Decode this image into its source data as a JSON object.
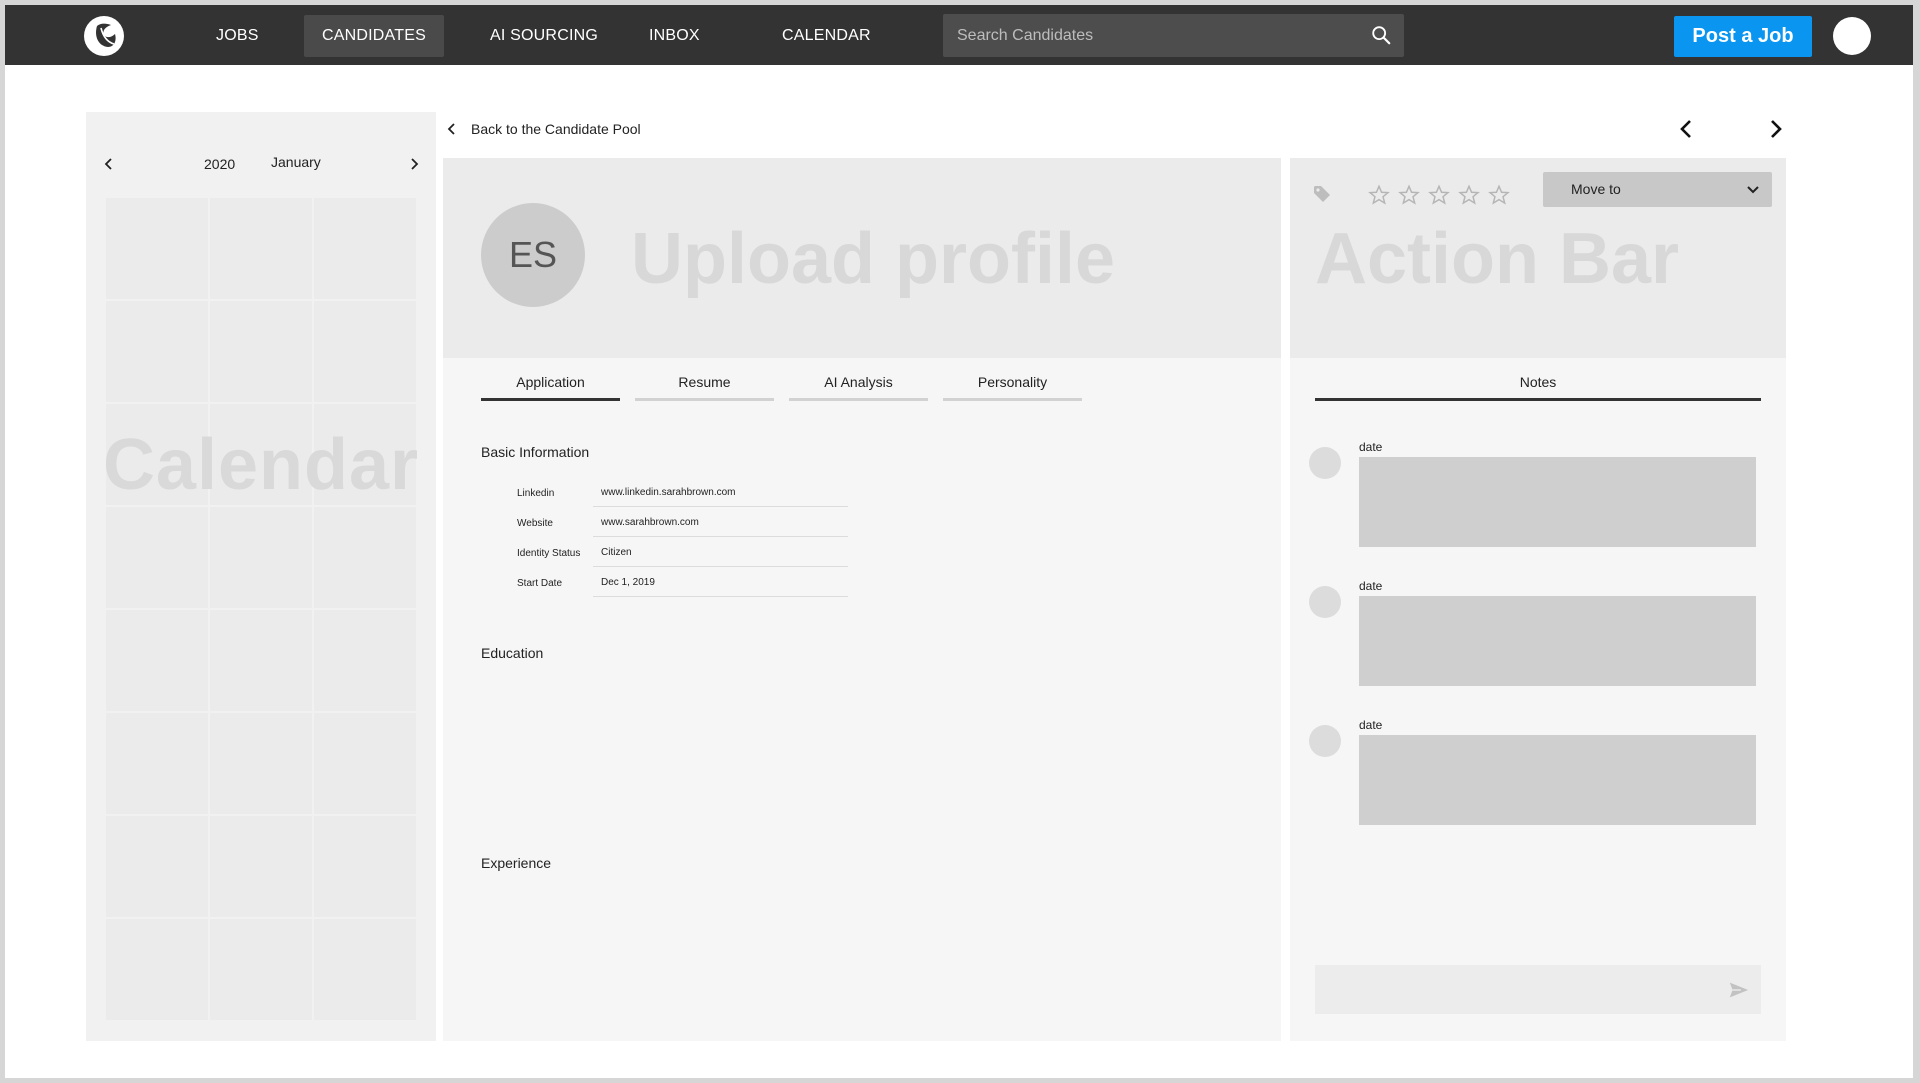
{
  "nav": {
    "items": [
      {
        "label": "JOBS",
        "active": false
      },
      {
        "label": "CANDIDATES",
        "active": true
      },
      {
        "label": "AI SOURCING",
        "active": false
      },
      {
        "label": "INBOX",
        "active": false
      },
      {
        "label": "CALENDAR",
        "active": false
      }
    ],
    "search_placeholder": "Search Candidates",
    "post_job_label": "Post a Job",
    "post_job_color": "#0a95f0"
  },
  "calendar": {
    "year": "2020",
    "month": "January",
    "watermark": "Calendar"
  },
  "candidate": {
    "back_label": "Back to the Candidate Pool",
    "initials": "ES",
    "header_placeholder": "Upload profile",
    "tabs": [
      "Application",
      "Resume",
      "AI Analysis",
      "Personality"
    ],
    "active_tab": "Application",
    "sections": {
      "basic": "Basic Information",
      "education": "Education",
      "experience": "Experience"
    },
    "basic_info": [
      {
        "label": "Linkedin",
        "value": "www.linkedin.sarahbrown.com"
      },
      {
        "label": "Website",
        "value": "www.sarahbrown.com"
      },
      {
        "label": "Identity Status",
        "value": "Citizen"
      },
      {
        "label": "Start Date",
        "value": "Dec 1, 2019"
      }
    ]
  },
  "action_bar": {
    "title": "Action Bar",
    "move_to_label": "Move to",
    "rating": 0,
    "notes_tab": "Notes",
    "notes": [
      {
        "date": "date"
      },
      {
        "date": "date"
      },
      {
        "date": "date"
      }
    ]
  }
}
